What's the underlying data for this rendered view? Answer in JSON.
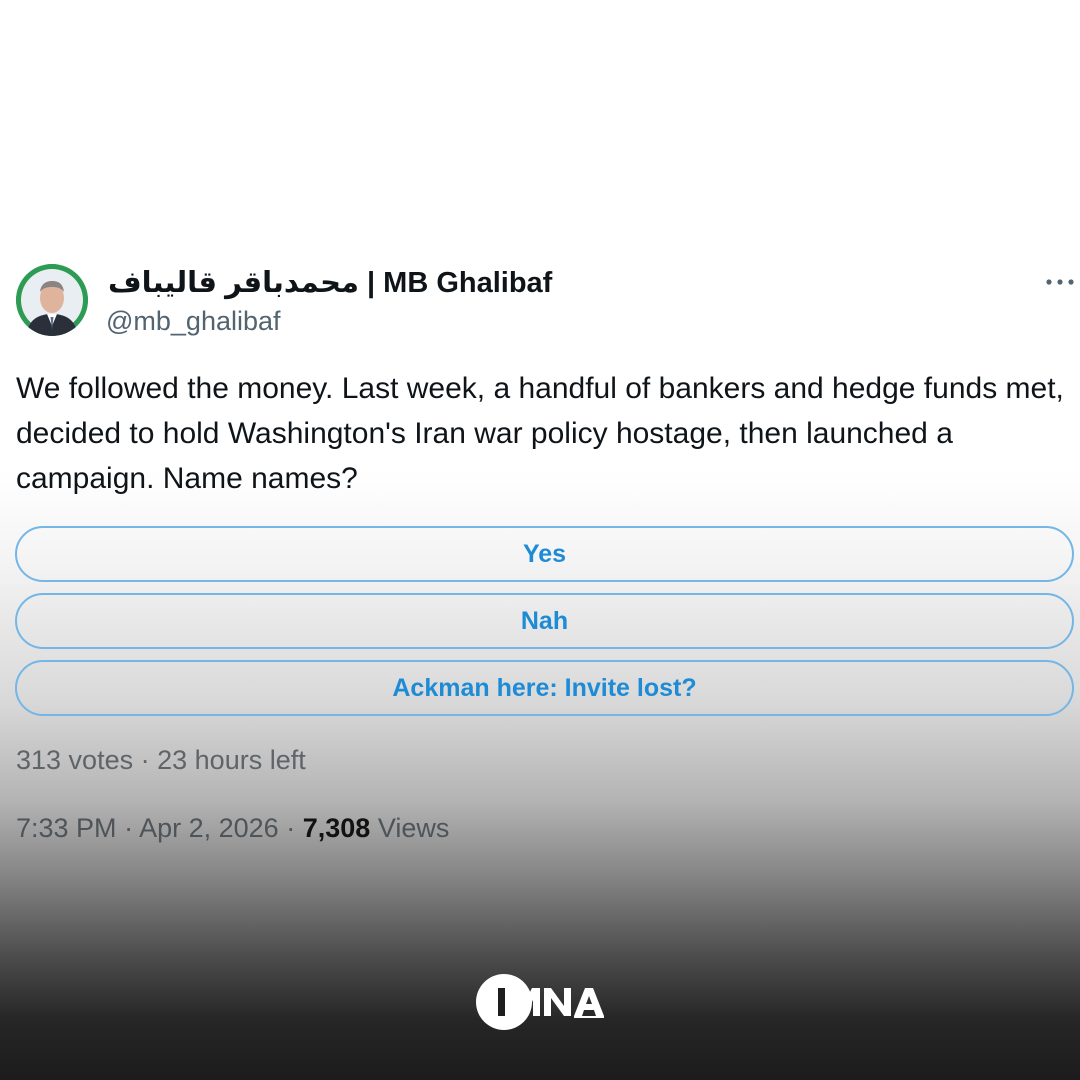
{
  "tweet": {
    "display_name": "محمدباقر قالیباف | MB Ghalibaf",
    "handle": "@mb_ghalibaf",
    "text": "We followed the money. Last week, a handful of bankers and hedge funds met, decided to hold Washington's Iran war policy hostage, then launched a campaign. Name names?",
    "more_icon": "more-horizontal-icon"
  },
  "poll": {
    "options": [
      {
        "label": "Yes"
      },
      {
        "label": "Nah"
      },
      {
        "label": "Ackman here: Invite lost?"
      }
    ],
    "votes": "313 votes",
    "separator": "·",
    "time_left": "23 hours left"
  },
  "meta": {
    "time": "7:33 PM",
    "separator": "·",
    "date": "Apr 2, 2026",
    "views_count": "7,308",
    "views_label": "Views"
  },
  "watermark": {
    "name": "IMNA"
  },
  "colors": {
    "poll_accent": "#1d8bd6",
    "poll_border": "#74b6e6",
    "text_primary": "#0f1419",
    "text_secondary": "#536471",
    "avatar_bg": "#2e9b55"
  }
}
